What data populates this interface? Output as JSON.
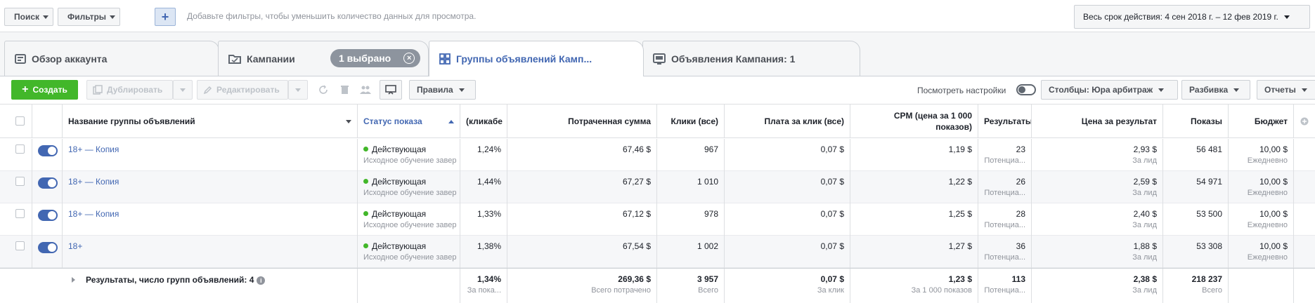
{
  "topbar": {
    "search_label": "Поиск",
    "filters_label": "Фильтры",
    "add_label": "+",
    "filter_hint": "Добавьте фильтры, чтобы уменьшить количество данных для просмотра.",
    "date_range": "Весь срок действия: 4 сен 2018 г. – 12 фев 2019 г."
  },
  "tabs": [
    {
      "label": "Обзор аккаунта",
      "icon": "account-overview-icon"
    },
    {
      "label": "Кампании",
      "icon": "campaigns-folder-icon"
    },
    {
      "label": "Группы объявлений Камп...",
      "icon": "ad-sets-grid-icon"
    },
    {
      "label": "Объявления Кампания: 1",
      "icon": "ads-screen-icon"
    }
  ],
  "selection_pill": {
    "label": "1 выбрано",
    "close": "×"
  },
  "toolbar": {
    "create_label": "Создать",
    "duplicate_label": "Дублировать",
    "edit_label": "Редактировать",
    "rules_label": "Правила",
    "view_settings_label": "Посмотреть настройки",
    "columns_label": "Столбцы: Юра арбитраж",
    "breakdown_label": "Разбивка",
    "reports_label": "Отчеты"
  },
  "columns": {
    "name": "Название группы объявлений",
    "delivery": "Статус показа",
    "ctr": "(кликабе",
    "spent": "Потраченная сумма",
    "clicks": "Клики (все)",
    "cpc": "Плата за клик (все)",
    "cpm": "CPM (цена за 1 000 показов)",
    "results": "Результаты",
    "cpr": "Цена за результат",
    "impressions": "Показы",
    "budget": "Бюджет"
  },
  "rows": [
    {
      "name": "18+ — Копия",
      "status": "Действующая",
      "status_sub": "Исходное обучение завер",
      "ctr": "1,24%",
      "spent": "67,46 $",
      "clicks": "967",
      "cpc": "0,07 $",
      "cpm": "1,19 $",
      "results": "23",
      "results_sub": "Потенциа...",
      "cpr": "2,93 $",
      "cpr_sub": "За лид",
      "impressions": "56 481",
      "budget": "10,00 $",
      "budget_sub": "Ежедневно"
    },
    {
      "name": "18+ — Копия",
      "status": "Действующая",
      "status_sub": "Исходное обучение завер",
      "ctr": "1,44%",
      "spent": "67,27 $",
      "clicks": "1 010",
      "cpc": "0,07 $",
      "cpm": "1,22 $",
      "results": "26",
      "results_sub": "Потенциа...",
      "cpr": "2,59 $",
      "cpr_sub": "За лид",
      "impressions": "54 971",
      "budget": "10,00 $",
      "budget_sub": "Ежедневно"
    },
    {
      "name": "18+ — Копия",
      "status": "Действующая",
      "status_sub": "Исходное обучение завер",
      "ctr": "1,33%",
      "spent": "67,12 $",
      "clicks": "978",
      "cpc": "0,07 $",
      "cpm": "1,25 $",
      "results": "28",
      "results_sub": "Потенциа...",
      "cpr": "2,40 $",
      "cpr_sub": "За лид",
      "impressions": "53 500",
      "budget": "10,00 $",
      "budget_sub": "Ежедневно"
    },
    {
      "name": "18+",
      "status": "Действующая",
      "status_sub": "Исходное обучение завер",
      "ctr": "1,38%",
      "spent": "67,54 $",
      "clicks": "1 002",
      "cpc": "0,07 $",
      "cpm": "1,27 $",
      "results": "36",
      "results_sub": "Потенциа...",
      "cpr": "1,88 $",
      "cpr_sub": "За лид",
      "impressions": "53 308",
      "budget": "10,00 $",
      "budget_sub": "Ежедневно"
    }
  ],
  "summary": {
    "label": "Результаты, число групп объявлений: 4",
    "ctr": "1,34%",
    "ctr_sub": "За пока...",
    "spent": "269,36 $",
    "spent_sub": "Всего потрачено",
    "clicks": "3 957",
    "clicks_sub": "Всего",
    "cpc": "0,07 $",
    "cpc_sub": "За клик",
    "cpm": "1,23 $",
    "cpm_sub": "За 1 000 показов",
    "results": "113",
    "results_sub": "Потенциа...",
    "cpr": "2,38 $",
    "cpr_sub": "За лид",
    "impressions": "218 237",
    "impressions_sub": "Всего"
  },
  "colors": {
    "accent": "#4267b2",
    "create": "#42b72a",
    "active_dot": "#42b72a"
  }
}
